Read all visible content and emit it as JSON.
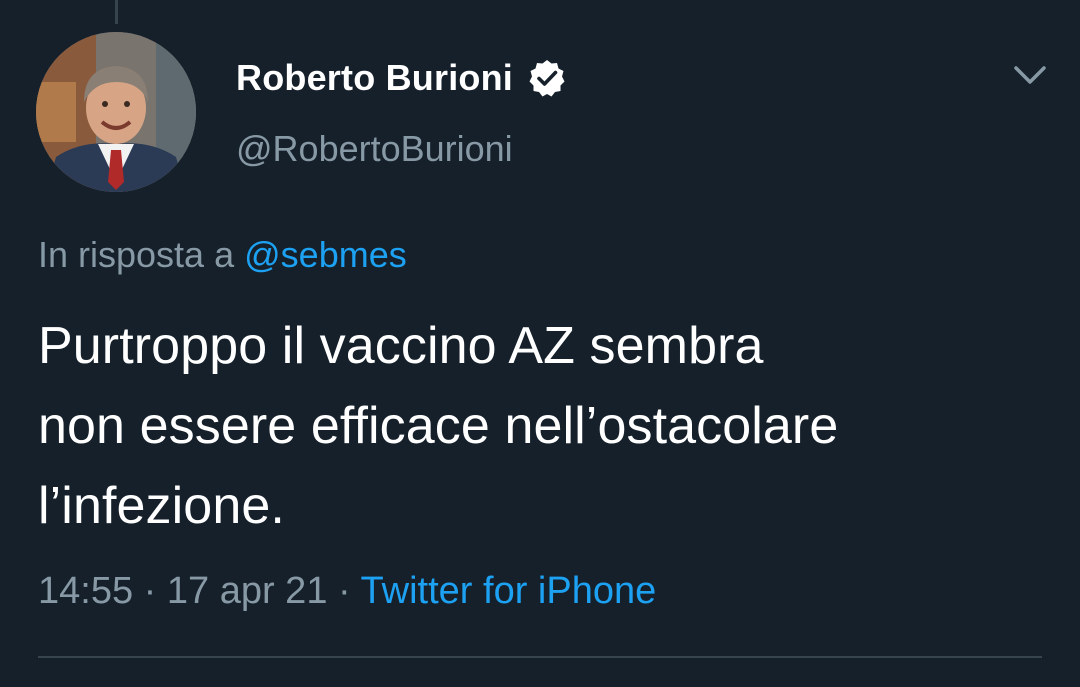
{
  "tweet": {
    "author": {
      "display_name": "Roberto Burioni",
      "username": "@RobertoBurioni",
      "verified_icon": "verified-badge-icon",
      "avatar": "profile-photo"
    },
    "more_icon": "chevron-down-icon",
    "reply_context": {
      "prefix": "In risposta a",
      "mention": "@sebmes"
    },
    "text_lines": [
      "Purtroppo il vaccino AZ sembra",
      "non essere efficace nell’ostacolare",
      "l’infezione."
    ],
    "meta": {
      "time": "14:55",
      "separator": "·",
      "date": "17 apr 21",
      "source": "Twitter for iPhone"
    }
  },
  "colors": {
    "background": "#15202b",
    "primary_text": "#ffffff",
    "secondary_text": "#8899a6",
    "accent": "#1da1f2",
    "divider": "#38444d"
  }
}
